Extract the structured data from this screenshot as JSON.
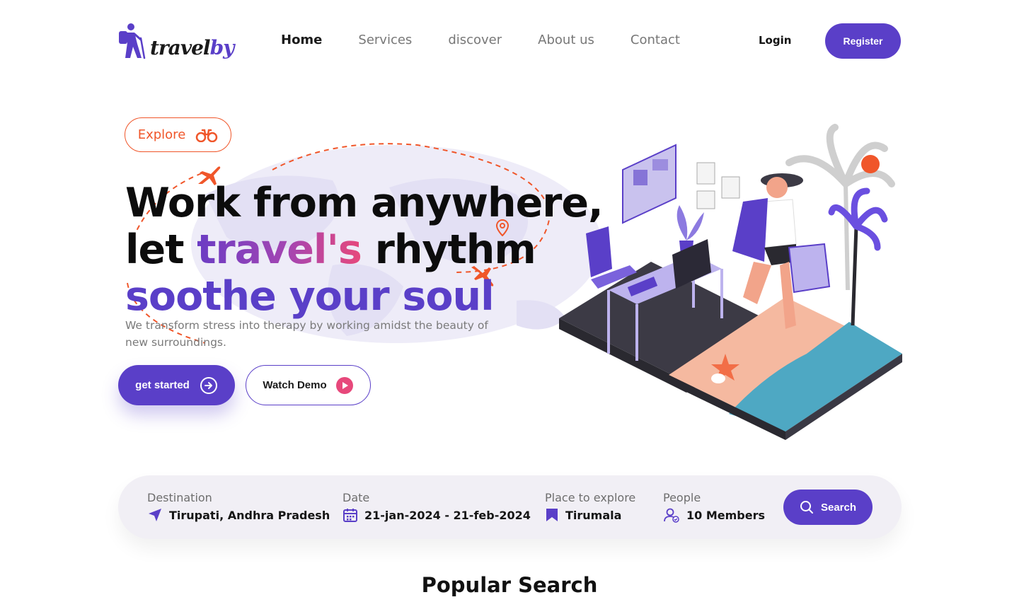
{
  "header": {
    "logo_main": "travel",
    "logo_accent": "by",
    "nav": [
      {
        "label": "Home",
        "active": true
      },
      {
        "label": "Services",
        "active": false
      },
      {
        "label": "discover",
        "active": false
      },
      {
        "label": "About us",
        "active": false
      },
      {
        "label": "Contact",
        "active": false
      }
    ],
    "login_label": "Login",
    "register_label": "Register"
  },
  "hero": {
    "badge_label": "Explore",
    "badge_icon": "binoculars-icon",
    "title_line1": "Work from anywhere,",
    "title_line2_prefix": "let ",
    "title_line2_highlight": "travel's",
    "title_line2_suffix": " rhythm",
    "title_line3": "soothe your soul",
    "subtitle": "We transform stress into therapy by working amidst the beauty of new surroundings.",
    "primary_button": "get started",
    "secondary_button": "Watch Demo"
  },
  "search": {
    "destination_label": "Destination",
    "destination_value": "Tirupati, Andhra Pradesh",
    "date_label": "Date",
    "date_value": "21-jan-2024 - 21-feb-2024",
    "place_label": "Place to explore",
    "place_value": "Tirumala",
    "people_label": "People",
    "people_value": "10 Members",
    "button_label": "Search"
  },
  "section_title": "Popular Search",
  "colors": {
    "brand": "#5a3fc8",
    "accent": "#f0562a",
    "pink": "#e7487b",
    "bar_bg": "#f1eff5"
  }
}
